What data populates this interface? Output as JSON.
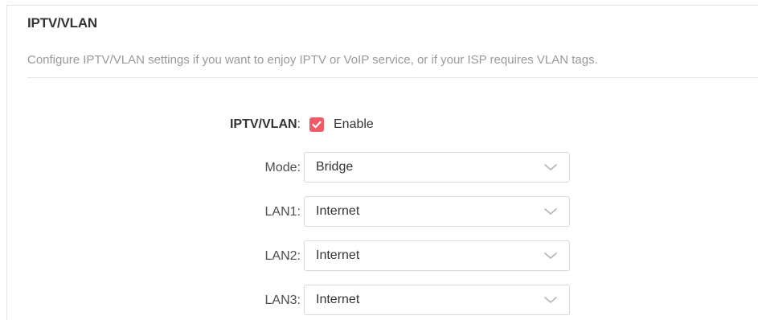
{
  "section": {
    "title": "IPTV/VLAN",
    "description": "Configure IPTV/VLAN settings if you want to enjoy IPTV or VoIP service, or if your ISP requires VLAN tags."
  },
  "form": {
    "iptv_vlan": {
      "label": "IPTV/VLAN",
      "colon": ":",
      "checkbox_label": "Enable",
      "checked": true
    },
    "mode": {
      "label": "Mode:",
      "value": "Bridge"
    },
    "lan1": {
      "label": "LAN1:",
      "value": "Internet"
    },
    "lan2": {
      "label": "LAN2:",
      "value": "Internet"
    },
    "lan3": {
      "label": "LAN3:",
      "value": "Internet"
    }
  },
  "icons": {
    "checkbox": "check-icon",
    "dropdown": "chevron-down-icon"
  },
  "colors": {
    "accent": "#f05a66",
    "title": "#333333",
    "description": "#999999"
  }
}
